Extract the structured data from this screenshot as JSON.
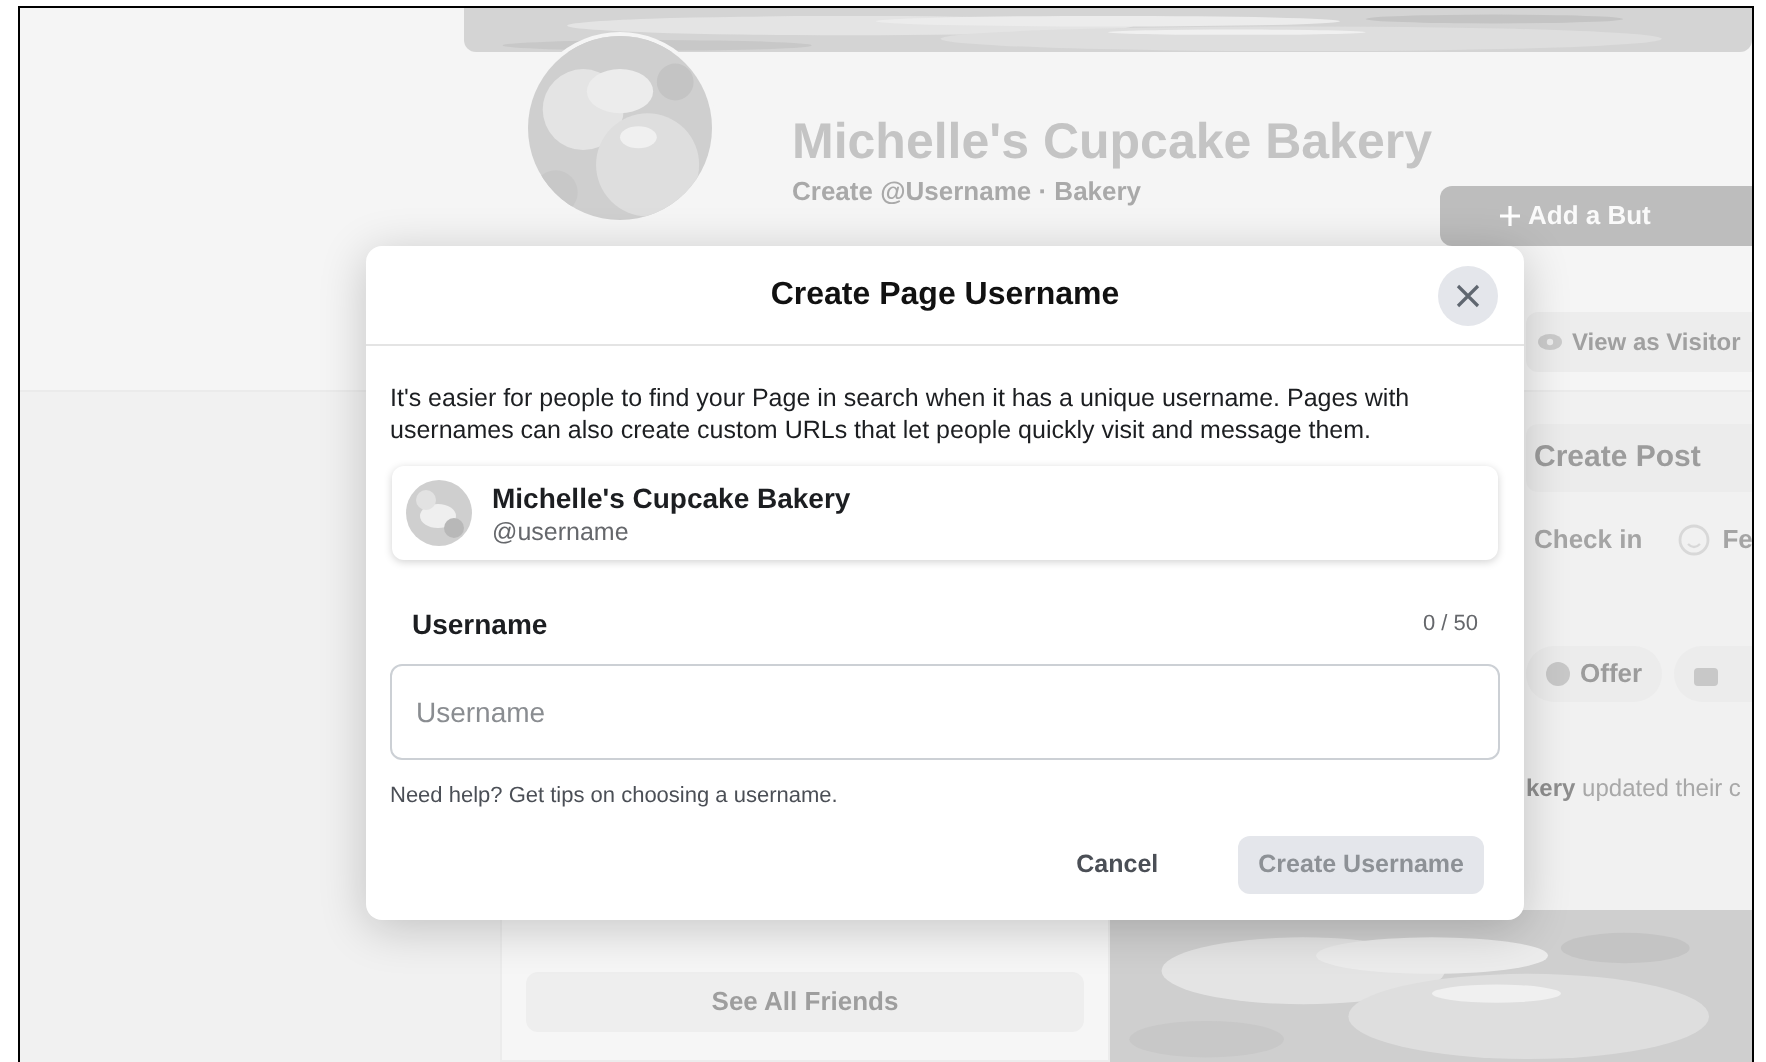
{
  "background_page": {
    "page_name": "Michelle's Cupcake Bakery",
    "subtitle": "Create @Username · Bakery",
    "add_button": "Add a But",
    "view_as_visitor": "View as Visitor",
    "create_post": "Create Post",
    "post_actions": [
      "Check in",
      "Fe"
    ],
    "chips": [
      {
        "label": "Offer",
        "kind": "offer"
      },
      {
        "kind": "cut"
      }
    ],
    "activity": {
      "name": "kery",
      "text": "updated their c"
    },
    "friends_button": "See All Friends"
  },
  "dialog": {
    "title": "Create Page Username",
    "description": "It's easier for people to find your Page in search when it has a unique username. Pages with usernames can also create custom URLs that let people quickly visit and message them.",
    "page_card": {
      "name": "Michelle's Cupcake Bakery",
      "handle": "@username"
    },
    "field": {
      "label": "Username",
      "counter": "0 / 50",
      "placeholder": "Username"
    },
    "help": "Need help? Get tips on choosing a username.",
    "buttons": [
      {
        "label": "Cancel",
        "kind": "text",
        "disabled": false
      },
      {
        "label": "Create Username",
        "kind": "primary",
        "disabled": true
      }
    ]
  }
}
